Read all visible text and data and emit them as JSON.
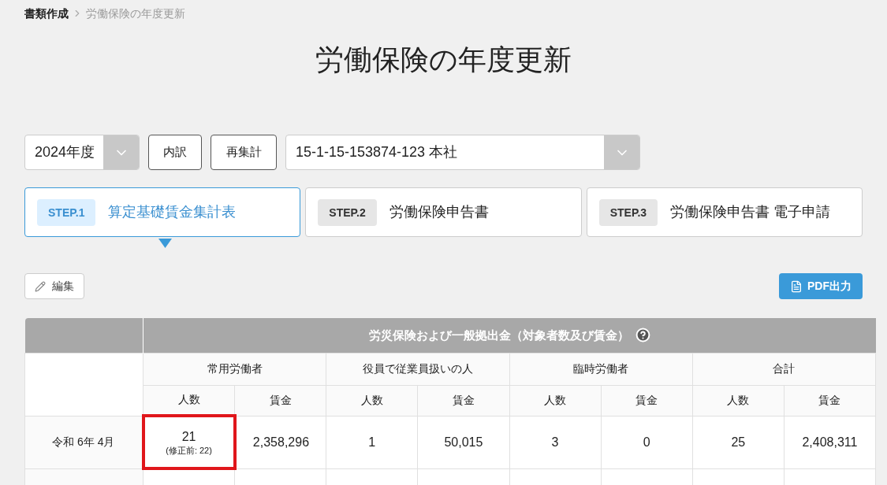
{
  "breadcrumb": [
    {
      "label": "書類作成",
      "current": false
    },
    {
      "label": "労働保険の年度更新",
      "current": true
    }
  ],
  "title": "労働保険の年度更新",
  "controls": {
    "year": {
      "value": "2024年度"
    },
    "breakdown_button": "内訳",
    "recalc_button": "再集計",
    "office": {
      "value": "15-1-15-153874-123 本社"
    }
  },
  "steps": [
    {
      "badge": "STEP.1",
      "title": "算定基礎賃金集計表",
      "selected": true
    },
    {
      "badge": "STEP.2",
      "title": "労働保険申告書",
      "selected": false
    },
    {
      "badge": "STEP.3",
      "title": "労働保険申告書 電子申請",
      "selected": false
    }
  ],
  "edit_button": "編集",
  "pdf_button": "PDF出力",
  "table": {
    "group_header": "労災保険および一般拠出金（対象者数及び賃金）",
    "categories": [
      "常用労働者",
      "役員で従業員扱いの人",
      "臨時労働者",
      "合計"
    ],
    "columns": [
      "人数",
      "賃金",
      "人数",
      "賃金",
      "人数",
      "賃金",
      "人数",
      "賃金"
    ],
    "rows": [
      {
        "month": "令和 6年 4月",
        "cells": [
          {
            "value": "21",
            "note": "(修正前: 22)",
            "highlighted": true
          },
          {
            "value": "2,358,296",
            "highlighted": false
          },
          {
            "value": "1",
            "highlighted": false
          },
          {
            "value": "50,015",
            "highlighted": false
          },
          {
            "value": "3",
            "highlighted": false
          },
          {
            "value": "0",
            "highlighted": false
          },
          {
            "value": "25",
            "highlighted": false
          },
          {
            "value": "2,408,311",
            "highlighted": false
          }
        ]
      }
    ]
  }
}
